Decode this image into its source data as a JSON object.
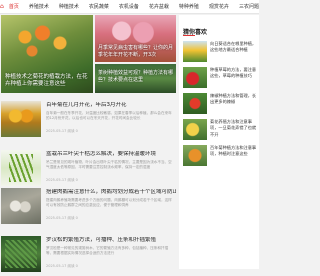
{
  "nav": {
    "items": [
      {
        "label": "首页",
        "active": true
      },
      {
        "label": "养殖技术"
      },
      {
        "label": "种植技术"
      },
      {
        "label": "农民蔬菜"
      },
      {
        "label": "农机设备"
      },
      {
        "label": "花卉盆栽"
      },
      {
        "label": "特种养殖"
      },
      {
        "label": "观赏花卉"
      },
      {
        "label": "三农问题"
      }
    ]
  },
  "hero": {
    "main_caption": "种植技术之菊花的植栽方法，在花卉种植上你需要注意这些",
    "top_right_caption": "月季常见病虫害有哪些？让你的月季花年年开花不断，开3次",
    "bottom_right_caption": "茶树种植效益可观？种植方法有哪些？技术要点在这里"
  },
  "articles": [
    {
      "title": "百年菊在几月开花，年后3月开花",
      "desc": "百年菊一般在冬季开花，对温度比较敏感，如果在春季以后种植，那么会在来年的12月份开花，以后也可以在冬天开花，开花时间会比较长",
      "meta": "2025-05-17  阅读 0"
    },
    {
      "title": "盆栽吊兰叶尖干枯怎么解决，要保持温暖环境",
      "desc": "吊兰是常见的观叶植物，叶片会出现叶尖干枯的情况，主要是因为浇水不当、空气湿度太低等原因，平时需要注意控制浇水频率，保持一定的湿度",
      "meta": "2025-05-17  阅读 0"
    },
    {
      "title": "搭建肉鹅需注意什么，肉鹅均划分成若干个区域可防止应激反应",
      "desc": "搭建肉鹅养殖场需要考虑多个方面的问题，肉鹅棚可以划分成若干个区域，这样可以有效防止鹅群之间的应激反应，便于管理和饲养",
      "meta": "2025-05-17  阅读 0"
    },
    {
      "title": "罗汉松的繁殖方法，可播种、压条和扦插繁殖",
      "desc": "罗汉松是一种常见的观赏树木，它的繁殖方法有多种，包括播种、压条和扦插等，需要根据实际情况选择合适的方法进行",
      "meta": "2025-05-17  阅读 0"
    }
  ],
  "sidebar": {
    "heading": "猜你喜欢",
    "items": [
      {
        "text": "向日葵适合在哪里种植，这些地方最适合种植"
      },
      {
        "text": "种植草莓的方法，要注意这些，草莓的种植技巧"
      },
      {
        "text": "辣椒种植方法和管理，长出更多的辣椒"
      },
      {
        "text": "菊花养殖方法和注意事项，一旦菊花弄错了也就不开"
      },
      {
        "text": "百年菊种植方法和注意事项，种植时注意这些"
      }
    ]
  },
  "colors": {
    "accent": "#dd3333",
    "sidebar_bg": "#ffffff",
    "page_bg": "#f2f2f2"
  }
}
